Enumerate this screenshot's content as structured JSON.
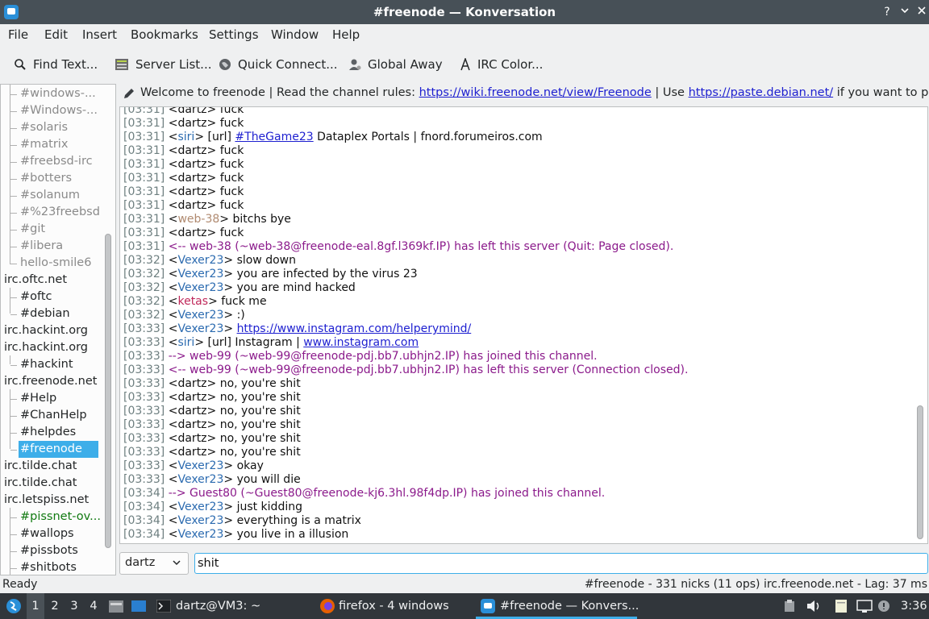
{
  "window": {
    "title": "#freenode — Konversation"
  },
  "menu": [
    "File",
    "Edit",
    "Insert",
    "Bookmarks",
    "Settings",
    "Window",
    "Help"
  ],
  "toolbar": {
    "find": "Find Text...",
    "server_list": "Server List...",
    "quick_connect": "Quick Connect...",
    "global_away": "Global Away",
    "irc_color": "IRC Color..."
  },
  "tree": [
    {
      "label": "#windows-...",
      "kind": "chan",
      "style": "gray"
    },
    {
      "label": "#Windows-...",
      "kind": "chan",
      "style": "gray"
    },
    {
      "label": "#solaris",
      "kind": "chan",
      "style": "gray"
    },
    {
      "label": "#matrix",
      "kind": "chan",
      "style": "gray"
    },
    {
      "label": "#freebsd-irc",
      "kind": "chan",
      "style": "gray"
    },
    {
      "label": "#botters",
      "kind": "chan",
      "style": "gray"
    },
    {
      "label": "#solanum",
      "kind": "chan",
      "style": "gray"
    },
    {
      "label": "#%23freebsd",
      "kind": "chan",
      "style": "gray"
    },
    {
      "label": "#git",
      "kind": "chan",
      "style": "gray"
    },
    {
      "label": "#libera",
      "kind": "chan",
      "style": "gray"
    },
    {
      "label": "hello-smile6",
      "kind": "chan",
      "style": "gray"
    },
    {
      "label": "irc.oftc.net",
      "kind": "server",
      "style": ""
    },
    {
      "label": "#oftc",
      "kind": "chan",
      "style": ""
    },
    {
      "label": "#debian",
      "kind": "chan",
      "style": ""
    },
    {
      "label": "irc.hackint.org",
      "kind": "server",
      "style": ""
    },
    {
      "label": "irc.hackint.org",
      "kind": "server",
      "style": ""
    },
    {
      "label": "#hackint",
      "kind": "chan",
      "style": ""
    },
    {
      "label": "irc.freenode.net",
      "kind": "server",
      "style": ""
    },
    {
      "label": "#Help",
      "kind": "chan",
      "style": ""
    },
    {
      "label": "#ChanHelp",
      "kind": "chan",
      "style": ""
    },
    {
      "label": "#helpdes",
      "kind": "chan",
      "style": ""
    },
    {
      "label": "#freenode",
      "kind": "chan",
      "style": "selected"
    },
    {
      "label": "irc.tilde.chat",
      "kind": "server",
      "style": ""
    },
    {
      "label": "irc.tilde.chat",
      "kind": "server",
      "style": ""
    },
    {
      "label": "irc.letspiss.net",
      "kind": "server",
      "style": ""
    },
    {
      "label": "#pissnet-ov...",
      "kind": "chan",
      "style": "green"
    },
    {
      "label": "#wallops",
      "kind": "chan",
      "style": ""
    },
    {
      "label": "#pissbots",
      "kind": "chan",
      "style": ""
    },
    {
      "label": "#shitbots",
      "kind": "chan",
      "style": ""
    }
  ],
  "topic": {
    "t1": "Welcome to freenode | Read the channel rules: ",
    "l1": "https://wiki.freenode.net/view/Freenode",
    "t2": " | Use ",
    "l2": "https://paste.debian.net/",
    "t3": " if you want to post ..."
  },
  "messages": [
    {
      "ts": "[03:31]",
      "nick": "dartz",
      "nc": "#111111",
      "text": "fuck"
    },
    {
      "ts": "[03:31]",
      "nick": "dartz",
      "nc": "#111111",
      "text": "fuck"
    },
    {
      "ts": "[03:31]",
      "nick": "siri",
      "nc": "#2c6bb0",
      "text": "[url] ",
      "link": "#TheGame23",
      "after": " Dataplex Portals | fnord.forumeiros.com"
    },
    {
      "ts": "[03:31]",
      "nick": "dartz",
      "nc": "#111111",
      "text": "fuck"
    },
    {
      "ts": "[03:31]",
      "nick": "dartz",
      "nc": "#111111",
      "text": "fuck"
    },
    {
      "ts": "[03:31]",
      "nick": "dartz",
      "nc": "#111111",
      "text": "fuck"
    },
    {
      "ts": "[03:31]",
      "nick": "dartz",
      "nc": "#111111",
      "text": "fuck"
    },
    {
      "ts": "[03:31]",
      "nick": "dartz",
      "nc": "#111111",
      "text": "fuck"
    },
    {
      "ts": "[03:31]",
      "nick": "web-38",
      "nc": "#b08a70",
      "text": "bitchs  bye"
    },
    {
      "ts": "[03:31]",
      "nick": "dartz",
      "nc": "#111111",
      "text": "fuck"
    },
    {
      "ts": "[03:31]",
      "event": "<-- web-38 (~web-38@freenode-eal.8gf.l369kf.IP) has left this server (Quit: Page closed)."
    },
    {
      "ts": "[03:32]",
      "nick": "Vexer23",
      "nc": "#2c6bb0",
      "text": "slow down"
    },
    {
      "ts": "[03:32]",
      "nick": "Vexer23",
      "nc": "#2c6bb0",
      "text": "you are infected by the virus 23"
    },
    {
      "ts": "[03:32]",
      "nick": "Vexer23",
      "nc": "#2c6bb0",
      "text": "you are mind hacked"
    },
    {
      "ts": "[03:32]",
      "nick": "ketas",
      "nc": "#c0285a",
      "text": "fuck me"
    },
    {
      "ts": "[03:32]",
      "nick": "Vexer23",
      "nc": "#2c6bb0",
      "text": ":)"
    },
    {
      "ts": "[03:33]",
      "nick": "Vexer23",
      "nc": "#2c6bb0",
      "text": "",
      "link": "https://www.instagram.com/helperymind/",
      "after": ""
    },
    {
      "ts": "[03:33]",
      "nick": "siri",
      "nc": "#2c6bb0",
      "text": "[url] Instagram | ",
      "link": "www.instagram.com",
      "after": ""
    },
    {
      "ts": "[03:33]",
      "event": "--> web-99 (~web-99@freenode-pdj.bb7.ubhjn2.IP) has joined this channel."
    },
    {
      "ts": "[03:33]",
      "event": "<-- web-99 (~web-99@freenode-pdj.bb7.ubhjn2.IP) has left this server (Connection closed)."
    },
    {
      "ts": "[03:33]",
      "nick": "dartz",
      "nc": "#111111",
      "text": "no, you're shit"
    },
    {
      "ts": "[03:33]",
      "nick": "dartz",
      "nc": "#111111",
      "text": "no, you're shit"
    },
    {
      "ts": "[03:33]",
      "nick": "dartz",
      "nc": "#111111",
      "text": "no, you're shit"
    },
    {
      "ts": "[03:33]",
      "nick": "dartz",
      "nc": "#111111",
      "text": "no, you're shit"
    },
    {
      "ts": "[03:33]",
      "nick": "dartz",
      "nc": "#111111",
      "text": "no, you're shit"
    },
    {
      "ts": "[03:33]",
      "nick": "dartz",
      "nc": "#111111",
      "text": "no, you're shit"
    },
    {
      "ts": "[03:33]",
      "nick": "Vexer23",
      "nc": "#2c6bb0",
      "text": "okay"
    },
    {
      "ts": "[03:33]",
      "nick": "Vexer23",
      "nc": "#2c6bb0",
      "text": "you will die"
    },
    {
      "ts": "[03:34]",
      "event": "--> Guest80 (~Guest80@freenode-kj6.3hl.98f4dp.IP) has joined this channel."
    },
    {
      "ts": "[03:34]",
      "nick": "Vexer23",
      "nc": "#2c6bb0",
      "text": "just kidding"
    },
    {
      "ts": "[03:34]",
      "nick": "Vexer23",
      "nc": "#2c6bb0",
      "text": "everything is a matrix"
    },
    {
      "ts": "[03:34]",
      "nick": "Vexer23",
      "nc": "#2c6bb0",
      "text": "you live in a illusion"
    }
  ],
  "input": {
    "nick": "dartz",
    "value": "shit"
  },
  "status": {
    "left": "Ready",
    "right": "#freenode - 331 nicks (11 ops)  irc.freenode.net - Lag: 37 ms"
  },
  "taskbar": {
    "desktops": [
      "1",
      "2",
      "3",
      "4"
    ],
    "terminal": "dartz@VM3: ~",
    "firefox": "firefox - 4 windows",
    "konversation": "#freenode — Konvers...",
    "clock": "3:36"
  },
  "colors": {
    "accent": "#3daee9",
    "event": "#8b1a8b",
    "link": "#1d1fd0"
  }
}
